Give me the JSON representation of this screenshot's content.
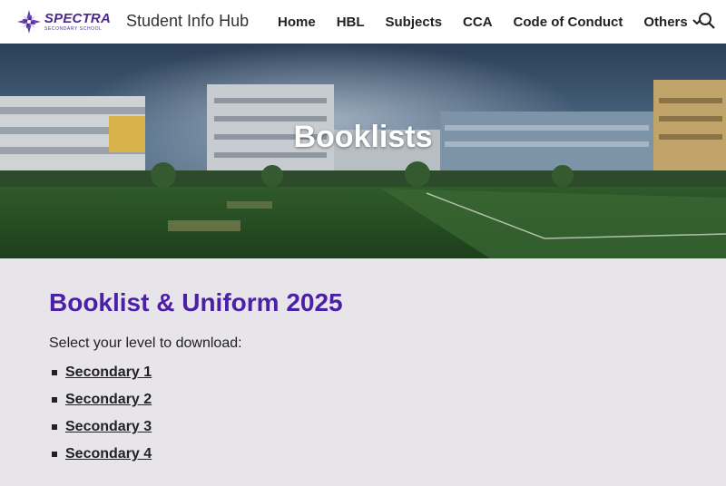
{
  "header": {
    "logo": {
      "main": "SPECTRA",
      "sub": "SECONDARY SCHOOL"
    },
    "site_title": "Student Info Hub",
    "nav": [
      {
        "label": "Home"
      },
      {
        "label": "HBL"
      },
      {
        "label": "Subjects"
      },
      {
        "label": "CCA"
      },
      {
        "label": "Code of Conduct"
      },
      {
        "label": "Others",
        "icon": "chevron-down-icon"
      }
    ],
    "search_icon": "search-icon"
  },
  "hero": {
    "title": "Booklists"
  },
  "main": {
    "heading": "Booklist & Uniform 2025",
    "intro": "Select your level to download:",
    "levels": [
      {
        "label": "Secondary 1"
      },
      {
        "label": "Secondary 2"
      },
      {
        "label": "Secondary 3"
      },
      {
        "label": "Secondary 4"
      }
    ]
  },
  "colors": {
    "accent": "#4b1fa6",
    "page_background": "#e7e4ea",
    "header_background": "#ffffff"
  }
}
